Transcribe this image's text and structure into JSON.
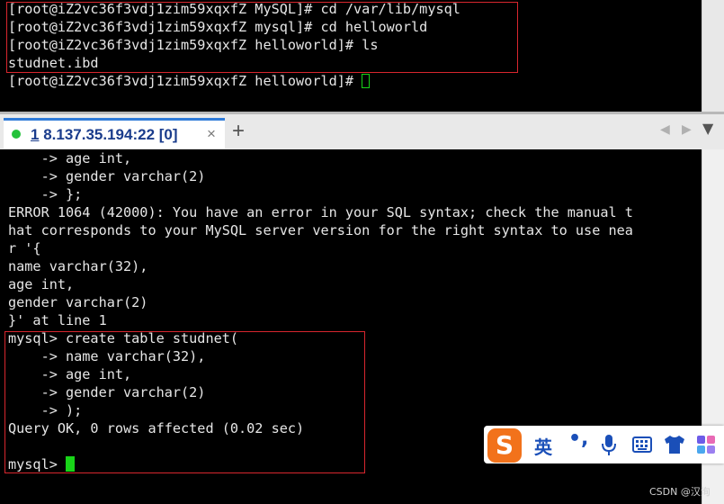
{
  "top_terminal": {
    "lines": [
      "[root@iZ2vc36f3vdj1zim59xqxfZ MySQL]# cd /var/lib/mysql",
      "[root@iZ2vc36f3vdj1zim59xqxfZ mysql]# cd helloworld",
      "[root@iZ2vc36f3vdj1zim59xqxfZ helloworld]# ls",
      "studnet.ibd",
      "[root@iZ2vc36f3vdj1zim59xqxfZ helloworld]# "
    ]
  },
  "tabs": {
    "active": {
      "index": "1",
      "label": "8.137.35.194:22 [0]",
      "close": "×",
      "status_color": "#24c23b"
    },
    "add_label": "+",
    "prev": "◀",
    "next": "▶",
    "menu": "▼"
  },
  "main_terminal": {
    "lines": [
      "    -> age int,",
      "    -> gender varchar(2)",
      "    -> };",
      "ERROR 1064 (42000): You have an error in your SQL syntax; check the manual t",
      "hat corresponds to your MySQL server version for the right syntax to use nea",
      "r '{",
      "name varchar(32),",
      "age int,",
      "gender varchar(2)",
      "}' at line 1",
      "mysql> create table studnet(",
      "    -> name varchar(32),",
      "    -> age int,",
      "    -> gender varchar(2)",
      "    -> );",
      "Query OK, 0 rows affected (0.02 sec)",
      "",
      "mysql> "
    ]
  },
  "ime_toolbar": {
    "logo": "S",
    "language": "英",
    "punctuation": "•,",
    "icons": [
      "microphone-icon",
      "keyboard-icon",
      "shirt-icon",
      "apps-icon"
    ]
  },
  "watermark": "CSDN @汉洵",
  "colors": {
    "terminal_bg": "#000000",
    "terminal_fg": "#e6e6e6",
    "cursor": "#18d418",
    "highlight_box": "#d8262e",
    "tab_accent": "#2f7bd8"
  }
}
